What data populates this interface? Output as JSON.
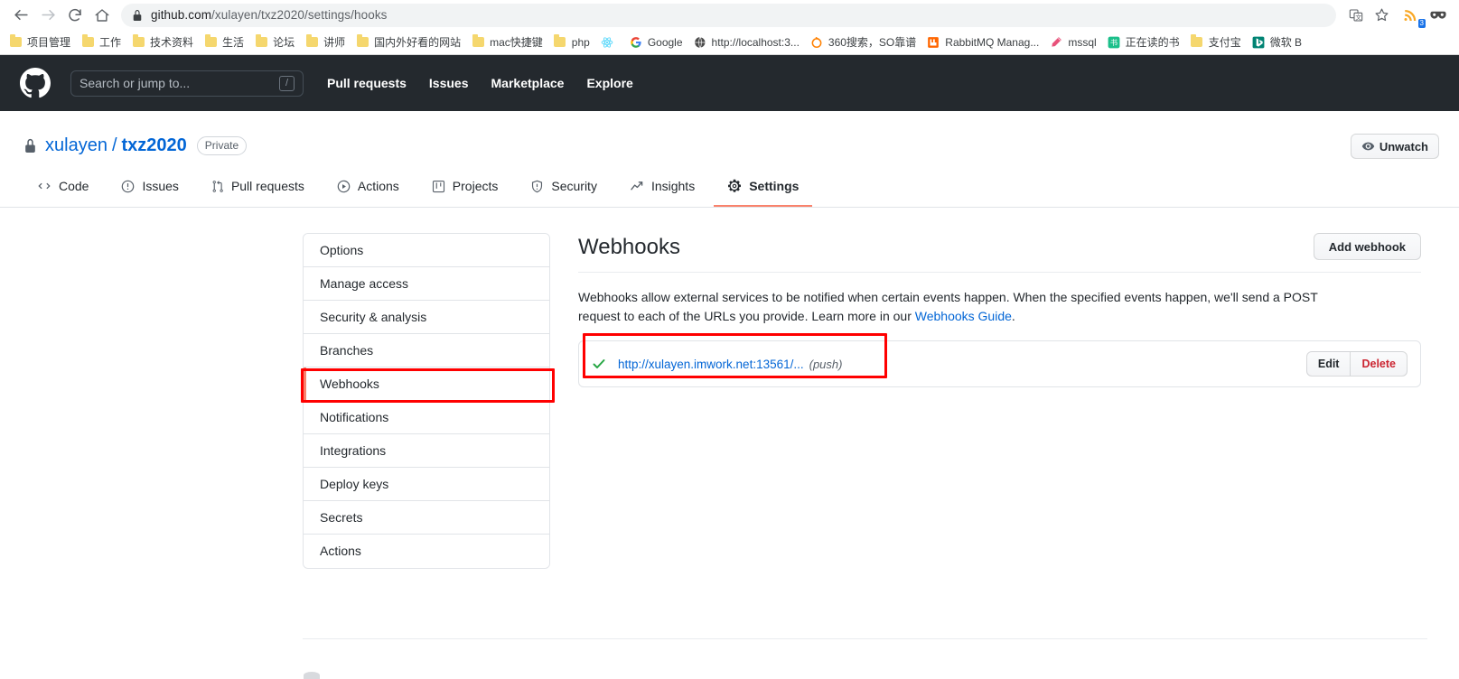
{
  "browser": {
    "back_icon": "back-arrow-icon",
    "forward_icon": "forward-arrow-icon",
    "reload_icon": "reload-icon",
    "home_icon": "home-icon",
    "lock_icon": "lock-icon",
    "url_host": "github.com",
    "url_path": "/xulayen/txz2020/settings/hooks",
    "url_full": "github.com/xulayen/txz2020/settings/hooks",
    "translate_icon": "translate-icon",
    "bookmark_star_icon": "star-icon",
    "rss_extension_icon": "rss-feed-icon",
    "rss_badge": "3",
    "adblock_extension_icon": "adblock-mask-icon",
    "bookmarks": [
      {
        "label": "项目管理",
        "icon": "folder-icon"
      },
      {
        "label": "工作",
        "icon": "folder-icon"
      },
      {
        "label": "技术资料",
        "icon": "folder-icon"
      },
      {
        "label": "生活",
        "icon": "folder-icon"
      },
      {
        "label": "论坛",
        "icon": "folder-icon"
      },
      {
        "label": "讲师",
        "icon": "folder-icon"
      },
      {
        "label": "国内外好看的网站",
        "icon": "folder-icon"
      },
      {
        "label": "mac快捷键",
        "icon": "folder-icon"
      },
      {
        "label": "php",
        "icon": "folder-icon"
      },
      {
        "label": "",
        "icon": "react-atom-icon"
      },
      {
        "label": "Google",
        "icon": "google-g-icon"
      },
      {
        "label": "http://localhost:3...",
        "icon": "globe-icon"
      },
      {
        "label": "360搜索，SO靠谱",
        "icon": "360-circle-icon"
      },
      {
        "label": "RabbitMQ Manag...",
        "icon": "rabbitmq-icon"
      },
      {
        "label": "mssql",
        "icon": "pencil-icon"
      },
      {
        "label": "正在读的书",
        "icon": "green-square-icon"
      },
      {
        "label": "支付宝",
        "icon": "folder-icon"
      },
      {
        "label": "微软 B",
        "icon": "bing-b-icon"
      }
    ]
  },
  "github_header": {
    "logo_icon": "github-mark-icon",
    "search_placeholder": "Search or jump to...",
    "search_value": "",
    "slash_key": "/",
    "nav": [
      {
        "label": "Pull requests"
      },
      {
        "label": "Issues"
      },
      {
        "label": "Marketplace"
      },
      {
        "label": "Explore"
      }
    ]
  },
  "repo": {
    "lock_icon": "lock-icon",
    "owner": "xulayen",
    "separator": "/",
    "name": "txz2020",
    "visibility_badge": "Private",
    "unwatch_label": "Unwatch",
    "unwatch_icon": "eye-icon",
    "tabs": [
      {
        "label": "Code",
        "icon": "code-icon",
        "selected": false
      },
      {
        "label": "Issues",
        "icon": "issue-opened-icon",
        "selected": false
      },
      {
        "label": "Pull requests",
        "icon": "git-pull-request-icon",
        "selected": false
      },
      {
        "label": "Actions",
        "icon": "play-circle-icon",
        "selected": false
      },
      {
        "label": "Projects",
        "icon": "project-board-icon",
        "selected": false
      },
      {
        "label": "Security",
        "icon": "shield-icon",
        "selected": false
      },
      {
        "label": "Insights",
        "icon": "graph-icon",
        "selected": false
      },
      {
        "label": "Settings",
        "icon": "gear-icon",
        "selected": true
      }
    ]
  },
  "settings_menu": {
    "items": [
      {
        "label": "Options",
        "selected": false
      },
      {
        "label": "Manage access",
        "selected": false
      },
      {
        "label": "Security & analysis",
        "selected": false
      },
      {
        "label": "Branches",
        "selected": false
      },
      {
        "label": "Webhooks",
        "selected": true
      },
      {
        "label": "Notifications",
        "selected": false
      },
      {
        "label": "Integrations",
        "selected": false
      },
      {
        "label": "Deploy keys",
        "selected": false
      },
      {
        "label": "Secrets",
        "selected": false
      },
      {
        "label": "Actions",
        "selected": false
      }
    ]
  },
  "webhooks": {
    "title": "Webhooks",
    "add_button": "Add webhook",
    "description_part1": "Webhooks allow external services to be notified when certain events happen. When the specified events happen, we'll send a POST request to each of the URLs you provide. Learn more in our ",
    "description_link": "Webhooks Guide",
    "description_part2": ".",
    "hooks": [
      {
        "status_icon": "check-icon",
        "status_color": "#28a745",
        "url": "http://xulayen.imwork.net:13561/...",
        "events": "(push)",
        "edit_label": "Edit",
        "delete_label": "Delete"
      }
    ]
  },
  "annotations": {
    "accent_color": "#ff0000",
    "boxes": [
      {
        "target": "settings-menu-item-webhooks"
      },
      {
        "target": "webhook-row"
      }
    ]
  }
}
